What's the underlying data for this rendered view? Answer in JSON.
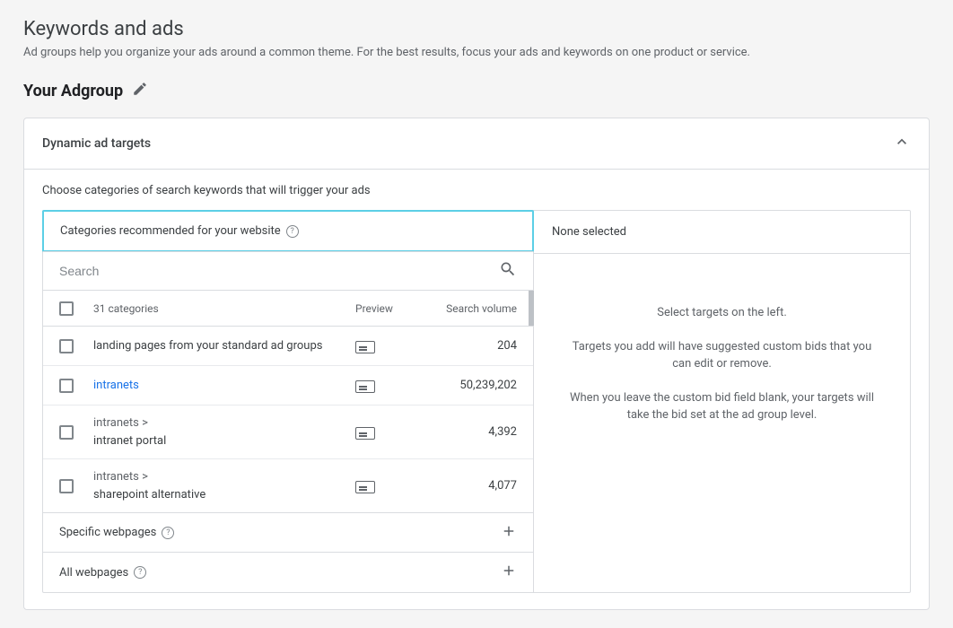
{
  "header": {
    "title": "Keywords and ads",
    "subtitle": "Ad groups help you organize your ads around a common theme. For the best results, focus your ads and keywords on one product or service."
  },
  "adgroup": {
    "title": "Your Adgroup"
  },
  "panel": {
    "title": "Dynamic ad targets",
    "instruction": "Choose categories of search keywords that will trigger your ads"
  },
  "tab": {
    "label": "Categories recommended for your website"
  },
  "search": {
    "placeholder": "Search"
  },
  "columns": {
    "count": "31 categories",
    "preview": "Preview",
    "volume": "Search volume"
  },
  "rows": [
    {
      "name_top": "",
      "name": "landing pages from your standard ad groups",
      "link": false,
      "volume": "204"
    },
    {
      "name_top": "",
      "name": "intranets",
      "link": true,
      "volume": "50,239,202"
    },
    {
      "name_top": "intranets >",
      "name": "intranet portal",
      "link": false,
      "volume": "4,392"
    },
    {
      "name_top": "intranets >",
      "name": "sharepoint alternative",
      "link": false,
      "volume": "4,077"
    }
  ],
  "sections": {
    "specific": "Specific webpages",
    "all": "All webpages"
  },
  "right": {
    "header": "None selected",
    "p1": "Select targets on the left.",
    "p2": "Targets you add will have suggested custom bids that you can edit or remove.",
    "p3": "When you leave the custom bid field blank, your targets will take the bid set at the ad group level."
  }
}
